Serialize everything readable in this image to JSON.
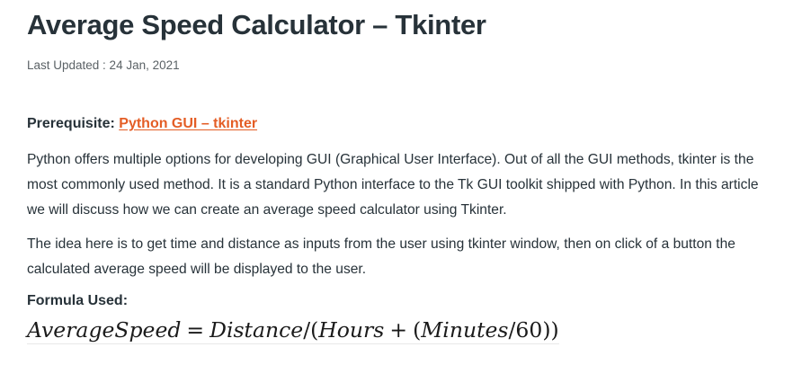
{
  "article": {
    "title": "Average Speed Calculator – Tkinter",
    "last_updated": "Last Updated : 24 Jan, 2021",
    "prerequisite_label": "Prerequisite: ",
    "prerequisite_link": "Python GUI – tkinter",
    "paragraph1": "Python offers multiple options for developing GUI (Graphical User Interface). Out of all the GUI methods, tkinter is the most commonly used method. It is a standard Python interface to the Tk GUI toolkit shipped with Python. In this article we will discuss how we can create an average speed calculator using Tkinter.",
    "paragraph2": "The idea here is to get time and distance as inputs from the user using tkinter window, then on click of a button the calculated average speed will be displayed to the user.",
    "formula_label": "Formula Used:",
    "formula": {
      "lhs": "AverageSpeed",
      "eq": "=",
      "distance": "Distance",
      "slash1": "/(",
      "hours": "Hours",
      "plus": "+",
      "paren_open": "(",
      "minutes": "Minutes",
      "tail": "/60))"
    }
  },
  "colors": {
    "text": "#273239",
    "link": "#e45d25",
    "muted": "#5b6266"
  }
}
